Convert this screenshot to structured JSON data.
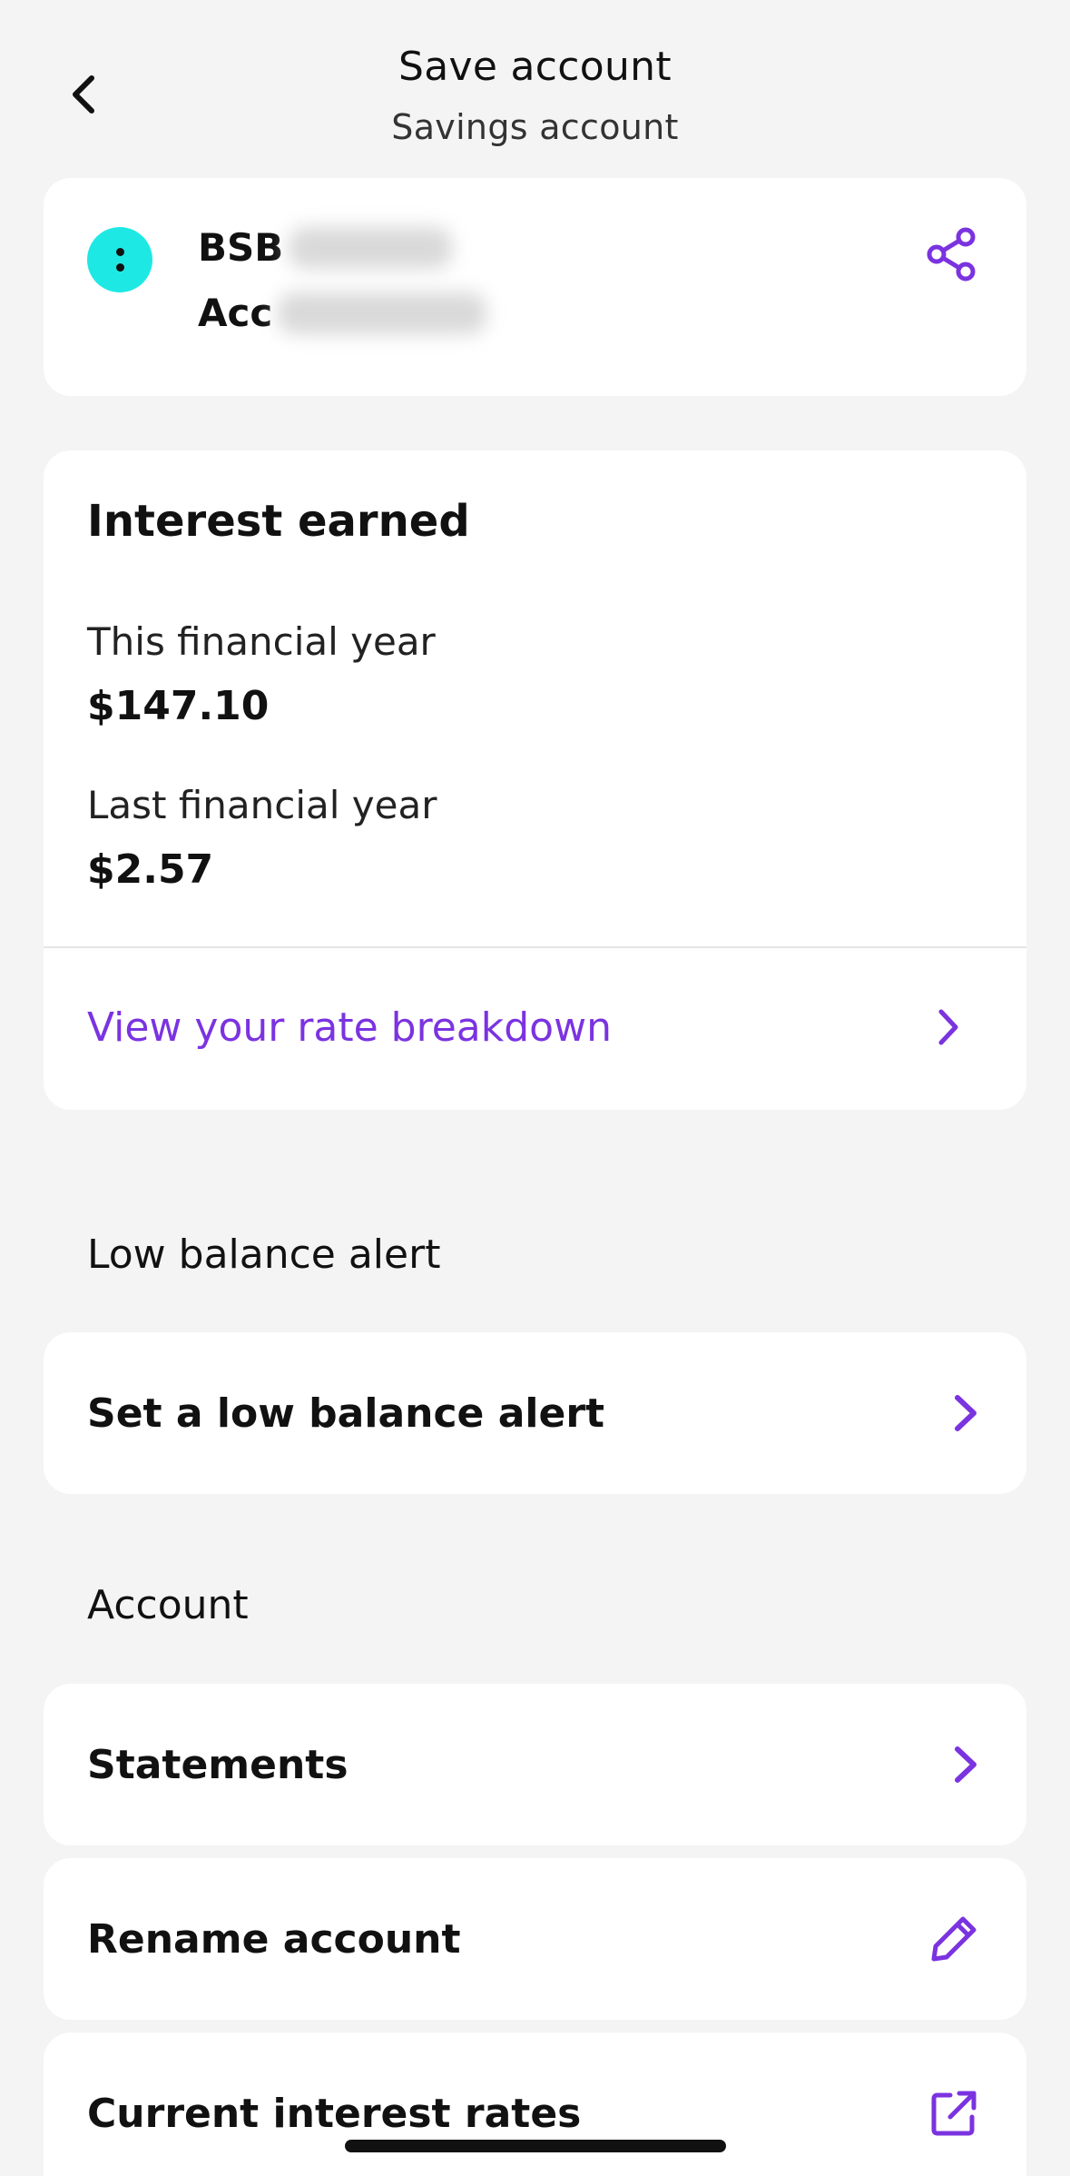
{
  "header": {
    "title": "Save account",
    "subtitle": "Savings account",
    "back_icon": "chevron-left-icon"
  },
  "account_card": {
    "bsb_label": "BSB",
    "account_label": "Acc",
    "logo_icon": "bank-logo-icon",
    "share_icon": "share-icon",
    "accent": "#1ee8e4"
  },
  "interest": {
    "title": "Interest earned",
    "this_year_label": "This financial year",
    "this_year_value": "$147.10",
    "last_year_label": "Last financial year",
    "last_year_value": "$2.57",
    "rate_link": "View your rate breakdown"
  },
  "low_balance": {
    "section_label": "Low balance alert",
    "row_label": "Set a low balance alert"
  },
  "account_section": {
    "section_label": "Account",
    "rows": [
      {
        "label": "Statements",
        "icon": "chevron-right-icon"
      },
      {
        "label": "Rename account",
        "icon": "pencil-icon"
      },
      {
        "label": "Current interest rates",
        "icon": "external-link-icon"
      }
    ]
  },
  "colors": {
    "brand_purple": "#7b33e0",
    "background": "#f4f4f4",
    "card": "#ffffff"
  }
}
